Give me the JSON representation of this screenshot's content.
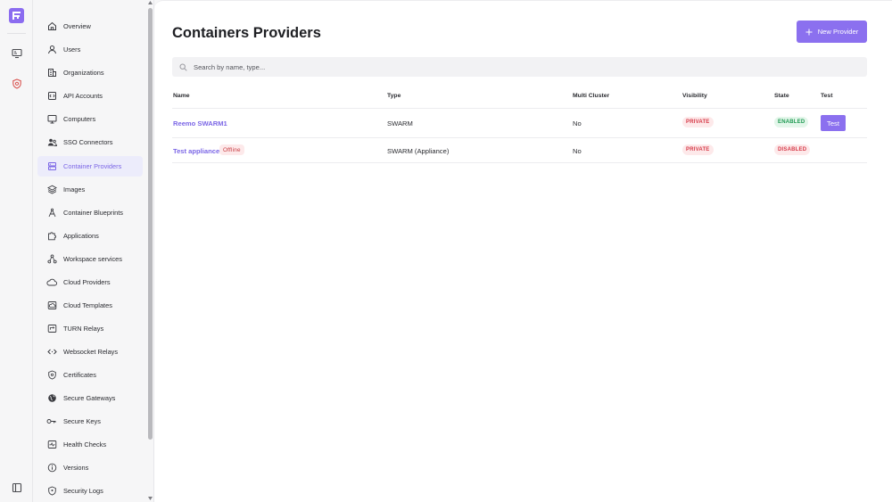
{
  "rail": {
    "icons": [
      "app-logo",
      "monitor-icon",
      "shield-icon",
      "sidebar-toggle-icon"
    ]
  },
  "sidebar": {
    "items": [
      {
        "label": "Overview",
        "icon": "home-icon"
      },
      {
        "label": "Users",
        "icon": "user-icon"
      },
      {
        "label": "Organizations",
        "icon": "building-icon"
      },
      {
        "label": "API Accounts",
        "icon": "code-box-icon"
      },
      {
        "label": "Computers",
        "icon": "monitor-icon"
      },
      {
        "label": "SSO Connectors",
        "icon": "users-icon"
      },
      {
        "label": "Container Providers",
        "icon": "server-icon",
        "active": true
      },
      {
        "label": "Images",
        "icon": "layers-icon"
      },
      {
        "label": "Container Blueprints",
        "icon": "compass-icon"
      },
      {
        "label": "Applications",
        "icon": "puzzle-icon"
      },
      {
        "label": "Workspace services",
        "icon": "nodes-icon"
      },
      {
        "label": "Cloud Providers",
        "icon": "cloud-icon"
      },
      {
        "label": "Cloud Templates",
        "icon": "cloud-template-icon"
      },
      {
        "label": "TURN Relays",
        "icon": "turn-relay-icon"
      },
      {
        "label": "Websocket Relays",
        "icon": "code-arrows-icon"
      },
      {
        "label": "Certificates",
        "icon": "certificate-icon"
      },
      {
        "label": "Secure Gateways",
        "icon": "globe-icon"
      },
      {
        "label": "Secure Keys",
        "icon": "key-icon"
      },
      {
        "label": "Health Checks",
        "icon": "health-icon"
      },
      {
        "label": "Versions",
        "icon": "info-icon"
      },
      {
        "label": "Security Logs",
        "icon": "shield-log-icon"
      }
    ]
  },
  "main": {
    "title": "Containers Providers",
    "new_button": "New Provider",
    "search_placeholder": "Search by name, type...",
    "columns": [
      "Name",
      "Type",
      "Multi Cluster",
      "Visibility",
      "State",
      "Test"
    ],
    "rows": [
      {
        "name": "Reemo SWARM1",
        "offline": "",
        "type": "SWARM",
        "multi_cluster": "No",
        "visibility": "PRIVATE",
        "state": "ENABLED",
        "test": "Test"
      },
      {
        "name": "Test appliance",
        "offline": "Offline",
        "type": "SWARM (Appliance)",
        "multi_cluster": "No",
        "visibility": "PRIVATE",
        "state": "DISABLED",
        "test": ""
      }
    ]
  },
  "colors": {
    "accent": "#8b70ef",
    "link": "#7b66e6",
    "private_badge": "#d63a48",
    "enabled_badge": "#1f9a52"
  }
}
